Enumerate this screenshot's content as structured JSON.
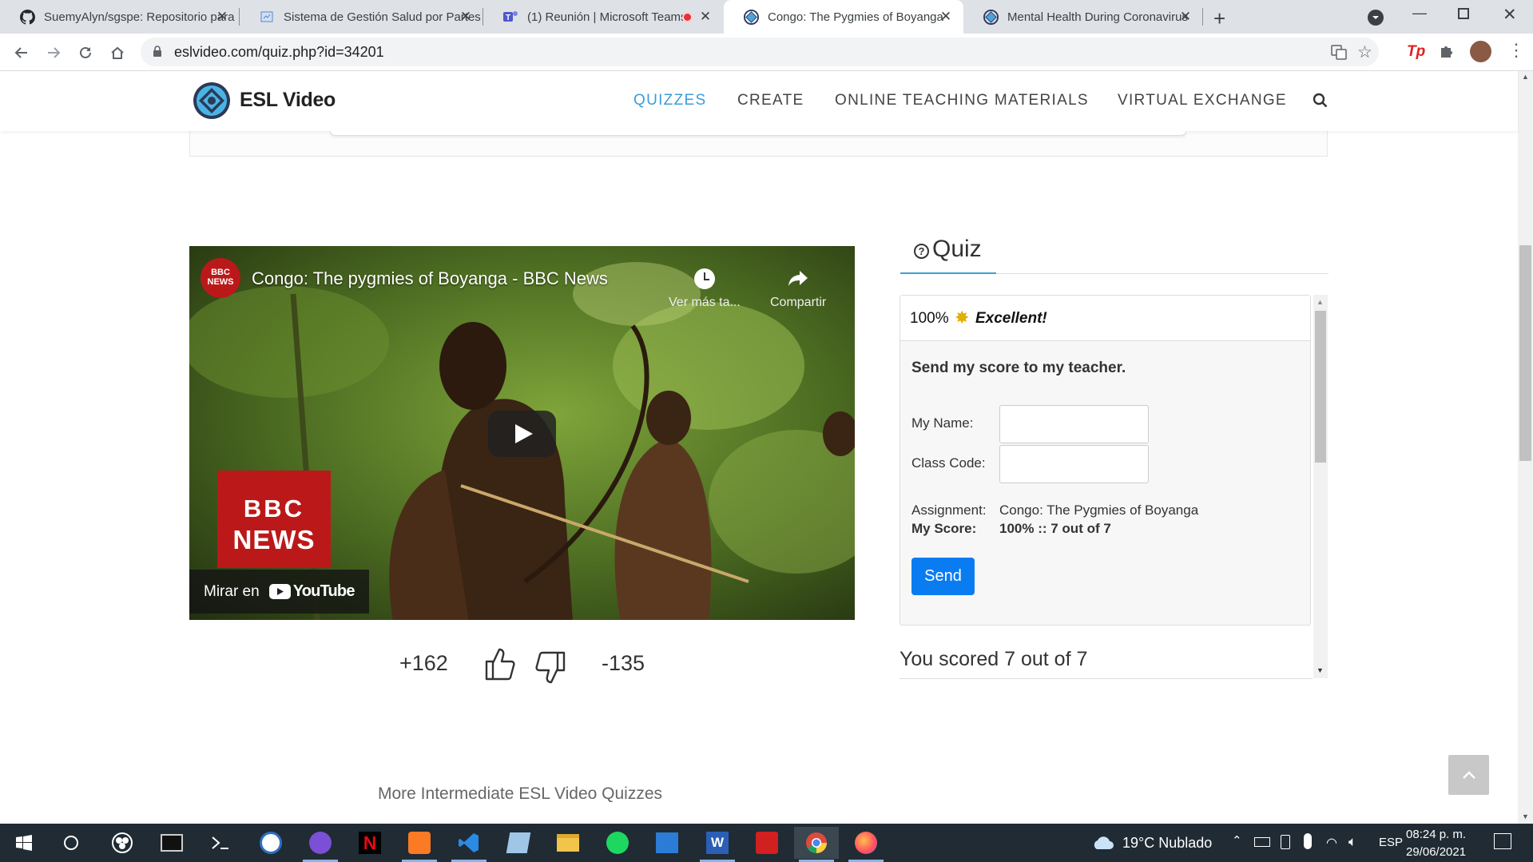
{
  "browser": {
    "tabs": [
      {
        "title": "SuemyAlyn/sgspe: Repositorio para",
        "icon": "github-icon"
      },
      {
        "title": "Sistema de Gestión Salud por Partes",
        "icon": "page-icon"
      },
      {
        "title": "(1) Reunión | Microsoft Teams",
        "icon": "teams-icon"
      },
      {
        "title": "Congo: The Pygmies of Boyanga",
        "icon": "eslvideo-icon"
      },
      {
        "title": "Mental Health During Coronavirus",
        "icon": "eslvideo-icon"
      }
    ],
    "url": "eslvideo.com/quiz.php?id=34201"
  },
  "site": {
    "logo_text": "ESL Video",
    "nav": [
      "QUIZZES",
      "CREATE",
      "ONLINE TEACHING MATERIALS",
      "VIRTUAL EXCHANGE"
    ]
  },
  "video": {
    "title": "Congo: The pygmies of Boyanga - BBC News",
    "channel_badge_top": "BBC",
    "channel_badge_bottom": "NEWS",
    "watch_later_label": "Ver más ta...",
    "share_label": "Compartir",
    "bbc_line1": "BBC",
    "bbc_line2": "NEWS",
    "watch_on_label": "Mirar en",
    "youtube_label": "YouTube"
  },
  "votes": {
    "likes": "+162",
    "dislikes": "-135"
  },
  "quiz": {
    "tab_label": "Quiz",
    "score_percent": "100%",
    "score_word": "Excellent!",
    "send_heading": "Send my score to my teacher.",
    "name_label": "My Name:",
    "class_code_label": "Class Code:",
    "assignment_label": "Assignment:",
    "assignment_value": "Congo: The Pygmies of Boyanga",
    "my_score_label": "My Score:",
    "my_score_value": "100% :: 7 out of 7",
    "send_button": "Send",
    "result": "You scored 7 out of 7"
  },
  "more_quizzes": "More Intermediate ESL Video Quizzes",
  "taskbar": {
    "weather": "19°C  Nublado",
    "lang": "ESP",
    "time": "08:24 p. m.",
    "date": "29/06/2021"
  }
}
